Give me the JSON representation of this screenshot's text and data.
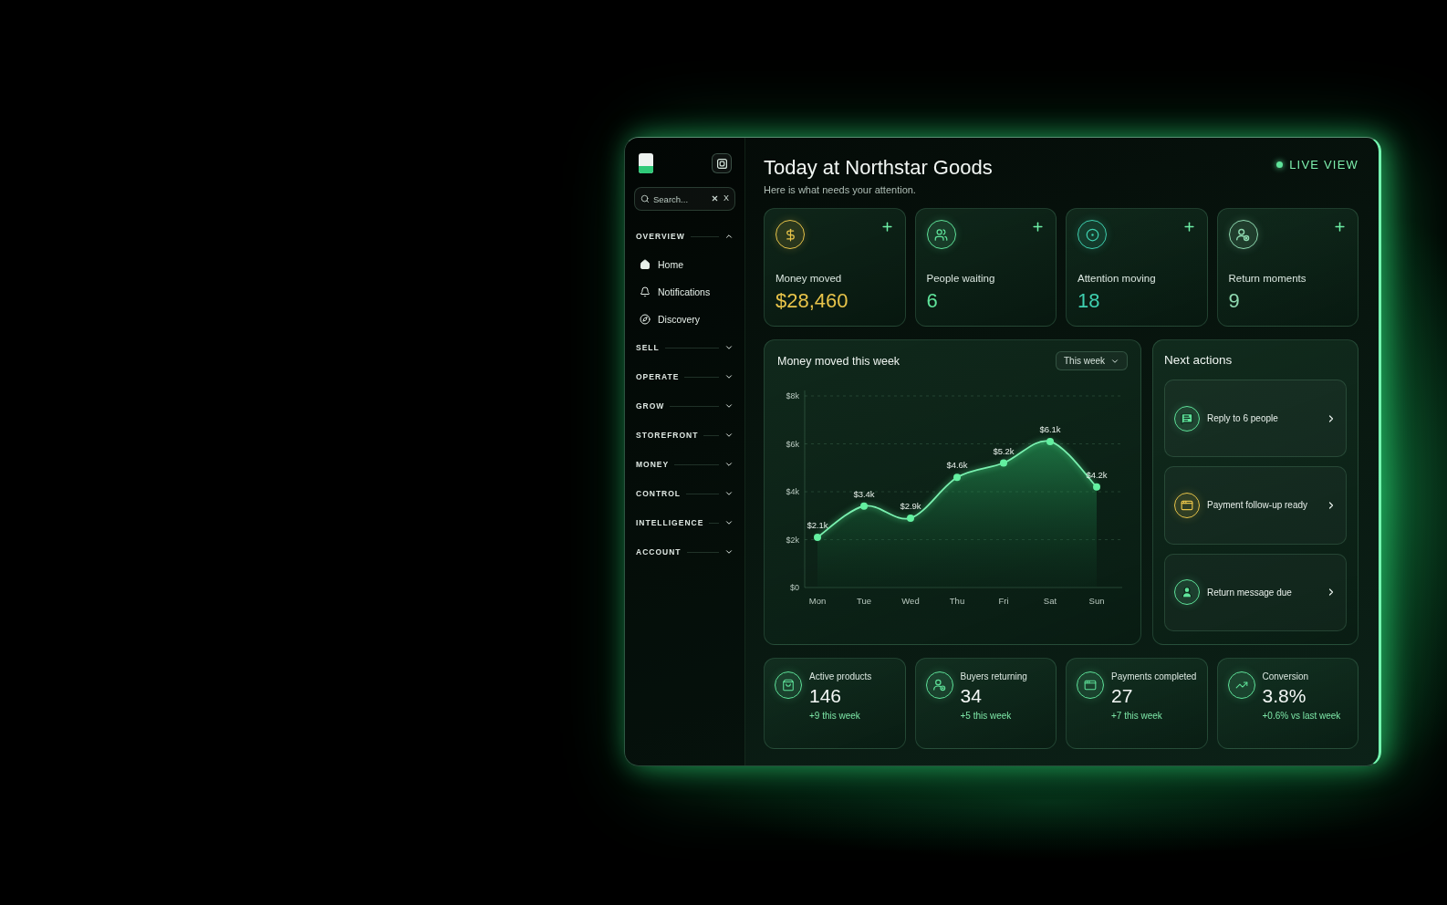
{
  "sidebar": {
    "search": {
      "placeholder": "Search...",
      "shortcut": "X"
    },
    "sections": [
      {
        "label": "OVERVIEW",
        "expanded": true,
        "items": [
          {
            "label": "Home"
          },
          {
            "label": "Notifications"
          },
          {
            "label": "Discovery"
          }
        ]
      },
      {
        "label": "SELL",
        "expanded": false
      },
      {
        "label": "OPERATE",
        "expanded": false
      },
      {
        "label": "GROW",
        "expanded": false
      },
      {
        "label": "STOREFRONT",
        "expanded": false
      },
      {
        "label": "MONEY",
        "expanded": false
      },
      {
        "label": "CONTROL",
        "expanded": false
      },
      {
        "label": "INTELLIGENCE",
        "expanded": false
      },
      {
        "label": "ACCOUNT",
        "expanded": false
      }
    ]
  },
  "header": {
    "title": "Today at Northstar Goods",
    "subtitle": "Here is what needs your attention.",
    "live_label": "LIVE VIEW"
  },
  "stat_cards": [
    {
      "label": "Money moved",
      "value": "$28,460",
      "color": "#e8c44a"
    },
    {
      "label": "People waiting",
      "value": "6",
      "color": "#5fe39a"
    },
    {
      "label": "Attention moving",
      "value": "18",
      "color": "#3fd0b0"
    },
    {
      "label": "Return moments",
      "value": "9",
      "color": "#8fd9b0"
    }
  ],
  "money_chart": {
    "range": "This week",
    "chart_data": {
      "type": "area",
      "title": "Money moved this week",
      "categories": [
        "Mon",
        "Tue",
        "Wed",
        "Thu",
        "Fri",
        "Sat",
        "Sun"
      ],
      "values": [
        2.1,
        3.4,
        2.9,
        4.6,
        5.2,
        6.1,
        4.2
      ],
      "ylim": [
        0,
        8
      ],
      "yticks": [
        {
          "value": 0,
          "label": "$0"
        },
        {
          "value": 2,
          "label": "$2k"
        },
        {
          "value": 4,
          "label": "$4k"
        },
        {
          "value": 6,
          "label": "$6k"
        },
        {
          "value": 8,
          "label": "$8k"
        }
      ],
      "grid": true,
      "marker": "circle",
      "value_labels": [
        "$2.1k",
        "$3.4k",
        "$2.9k",
        "$4.6k",
        "$5.2k",
        "$6.1k",
        "$4.2k"
      ]
    }
  },
  "next_actions": {
    "title": "Next actions",
    "items": [
      {
        "label": "Reply to 6 people",
        "color": "#5fe39a"
      },
      {
        "label": "Payment follow-up ready",
        "color": "#e8c44a"
      },
      {
        "label": "Return message due",
        "color": "#5fe39a"
      }
    ]
  },
  "summary_cards": [
    {
      "label": "Active products",
      "value": "146",
      "delta": "+9 this week"
    },
    {
      "label": "Buyers returning",
      "value": "34",
      "delta": "+5 this week"
    },
    {
      "label": "Payments completed",
      "value": "27",
      "delta": "+7 this week"
    },
    {
      "label": "Conversion",
      "value": "3.8%",
      "delta": "+0.6% vs last week"
    }
  ]
}
